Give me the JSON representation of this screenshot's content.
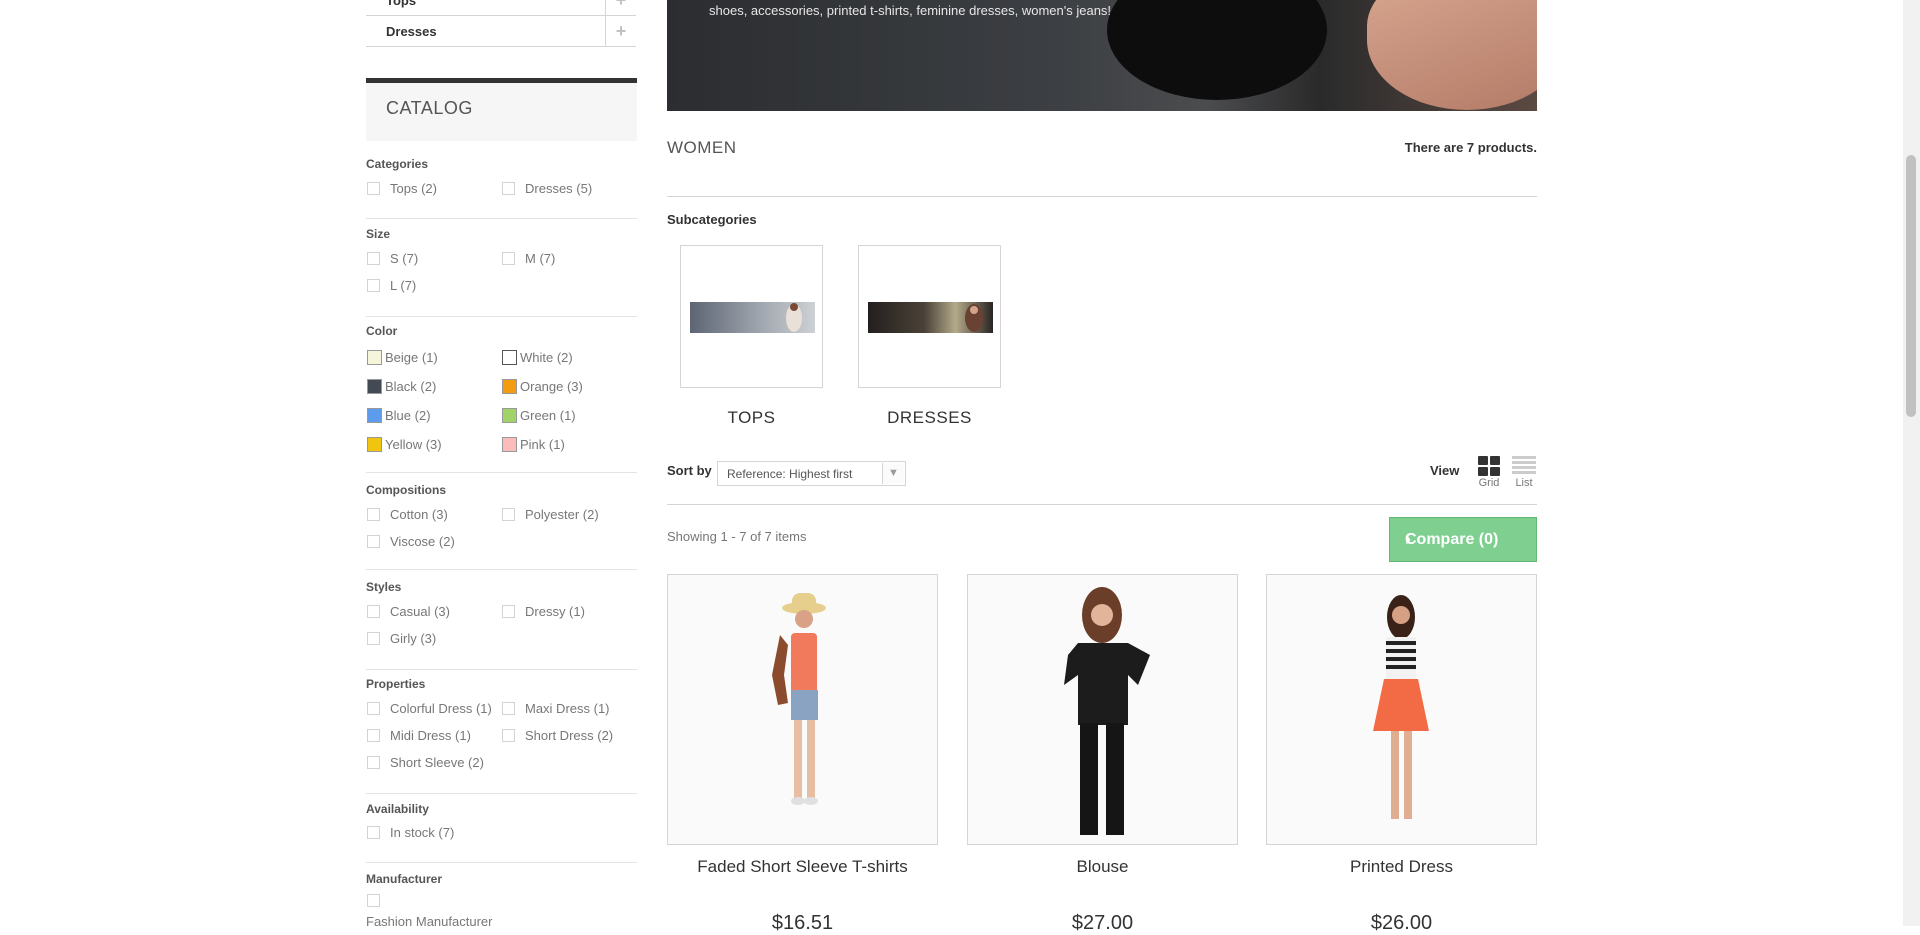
{
  "tree": [
    {
      "label": "Tops"
    },
    {
      "label": "Dresses"
    }
  ],
  "catalog_title": "CATALOG",
  "filters": {
    "categories": {
      "title": "Categories",
      "items": [
        "Tops (2)",
        "Dresses (5)"
      ]
    },
    "size": {
      "title": "Size",
      "items": [
        "S (7)",
        "M (7)",
        "L (7)"
      ]
    },
    "color": {
      "title": "Color",
      "items": [
        {
          "label": "Beige (1)",
          "color": "#f5f5dc"
        },
        {
          "label": "White (2)",
          "color": "#ffffff"
        },
        {
          "label": "Black (2)",
          "color": "#434a54"
        },
        {
          "label": "Orange (3)",
          "color": "#f39c11"
        },
        {
          "label": "Blue (2)",
          "color": "#5d9cec"
        },
        {
          "label": "Green (1)",
          "color": "#a0d468"
        },
        {
          "label": "Yellow (3)",
          "color": "#f1c40f"
        },
        {
          "label": "Pink (1)",
          "color": "#fcbcbc"
        }
      ]
    },
    "compositions": {
      "title": "Compositions",
      "items": [
        "Cotton (3)",
        "Polyester (2)",
        "Viscose (2)"
      ]
    },
    "styles": {
      "title": "Styles",
      "items": [
        "Casual (3)",
        "Dressy (1)",
        "Girly (3)"
      ]
    },
    "properties": {
      "title": "Properties",
      "items": [
        "Colorful Dress (1)",
        "Maxi Dress (1)",
        "Midi Dress (1)",
        "Short Dress (2)",
        "Short Sleeve (2)"
      ]
    },
    "availability": {
      "title": "Availability",
      "items": [
        "In stock (7)"
      ]
    },
    "manufacturer": {
      "title": "Manufacturer",
      "items": [
        "Fashion Manufacturer"
      ]
    }
  },
  "banner_text": "shoes, accessories, printed t-shirts, feminine dresses, women's jeans!",
  "category_name": "WOMEN",
  "product_count": "There are 7 products.",
  "subcategories_title": "Subcategories",
  "subcategories": [
    "TOPS",
    "DRESSES"
  ],
  "sort": {
    "label": "Sort by",
    "selected": "Reference: Highest first"
  },
  "view": {
    "label": "View",
    "grid": "Grid",
    "list": "List"
  },
  "showing": "Showing 1 - 7 of 7 items",
  "compare": "Compare (0)",
  "products": [
    {
      "name": "Faded Short Sleeve T-shirts",
      "price": "$16.51"
    },
    {
      "name": "Blouse",
      "price": "$27.00"
    },
    {
      "name": "Printed Dress",
      "price": "$26.00"
    }
  ],
  "colors": {
    "accent_green": "#7fcf91",
    "dark": "#333333"
  }
}
